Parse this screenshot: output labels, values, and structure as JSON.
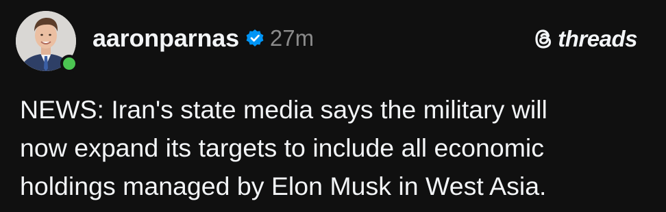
{
  "author": {
    "username": "aaronparnas",
    "timestamp": "27m",
    "verified": true,
    "online_status_color": "#4cc552"
  },
  "brand": {
    "label": "threads",
    "icon": "threads-logo-icon"
  },
  "post": {
    "lines": [
      "NEWS: Iran's state media says the military will",
      "now expand its targets to include all economic",
      "holdings managed by Elon Musk in West Asia."
    ]
  },
  "colors": {
    "background": "#101010",
    "text": "#f3f5f7",
    "muted": "#8a8a8a",
    "verified_badge": "#0095f6"
  }
}
